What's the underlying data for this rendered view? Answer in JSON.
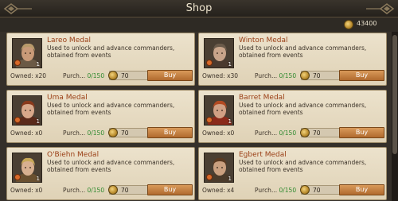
{
  "header": {
    "title": "Shop"
  },
  "currency": {
    "amount": "43400",
    "icon": "gold-coin-icon"
  },
  "labels": {
    "purchase_prefix": "Purch..."
  },
  "cards": [
    {
      "name": "Lareo Medal",
      "description": "Used to unlock and advance commanders, obtained from events",
      "qty": "1",
      "owned": "Owned: x20",
      "limit": "0/150",
      "price": "70",
      "buy": "Buy",
      "hair": "#b89a6a",
      "skin": "#c99a78",
      "cloth": "#6b5a45"
    },
    {
      "name": "Winton Medal",
      "description": "Used to unlock and advance commanders, obtained from events",
      "qty": "1",
      "owned": "Owned: x30",
      "limit": "0/150",
      "price": "70",
      "buy": "Buy",
      "hair": "#6a5a4a",
      "skin": "#c8a48a",
      "cloth": "#4a3a2e"
    },
    {
      "name": "Uma Medal",
      "description": "Used to unlock and advance commanders, obtained from events",
      "qty": "1",
      "owned": "Owned: x0",
      "limit": "0/150",
      "price": "70",
      "buy": "Buy",
      "hair": "#8a3a1c",
      "skin": "#d8a88a",
      "cloth": "#5a2a1a"
    },
    {
      "name": "Barret Medal",
      "description": "Used to unlock and advance commanders, obtained from events",
      "qty": "1",
      "owned": "Owned: x0",
      "limit": "0/150",
      "price": "70",
      "buy": "Buy",
      "hair": "#b24a22",
      "skin": "#d0a084",
      "cloth": "#8a2a1a"
    },
    {
      "name": "O'Biehn Medal",
      "description": "Used to unlock and advance commanders, obtained from events",
      "qty": "1",
      "owned": "Owned: x0",
      "limit": "0/150",
      "price": "70",
      "buy": "Buy",
      "hair": "#c8a858",
      "skin": "#d8b090",
      "cloth": "#6a5030"
    },
    {
      "name": "Egbert Medal",
      "description": "Used to unlock and advance commanders, obtained from events",
      "qty": "1",
      "owned": "Owned: x4",
      "limit": "0/150",
      "price": "70",
      "buy": "Buy",
      "hair": "#5a3a22",
      "skin": "#caa080",
      "cloth": "#4a3a2a"
    }
  ]
}
